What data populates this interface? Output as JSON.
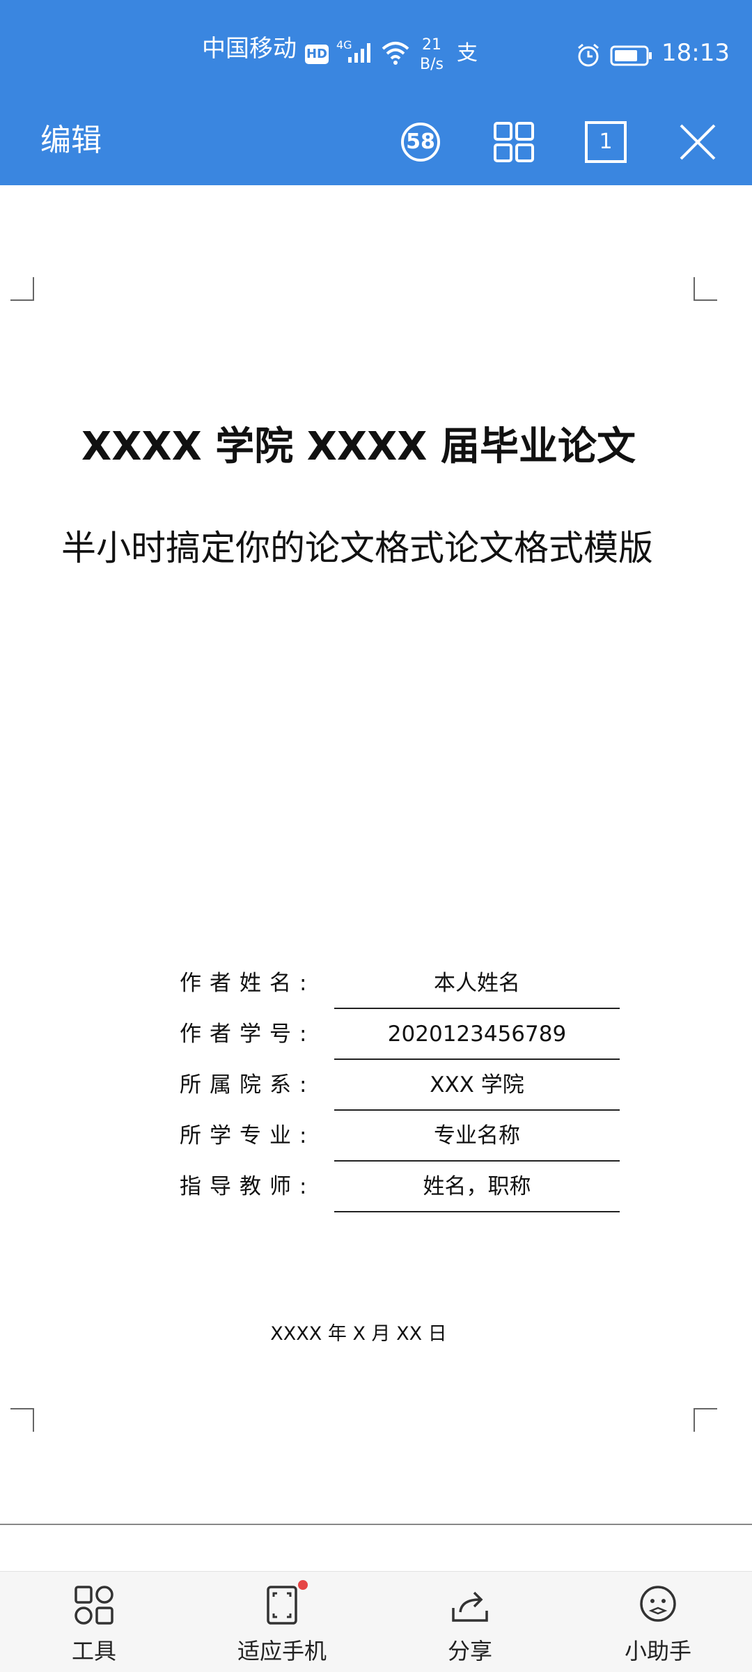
{
  "status_bar": {
    "carrier": "中国移动",
    "hd_badge": "HD",
    "network_type": "4G",
    "speed_value": "21",
    "speed_unit": "B/s",
    "alipay_glyph": "支",
    "time": "18:13"
  },
  "toolbar": {
    "edit_label": "编辑",
    "notification_count": "58",
    "page_number": "1",
    "icons": [
      "notification-count-icon",
      "grid-view-icon",
      "page-count-icon",
      "close-icon"
    ]
  },
  "document": {
    "title": "XXXX 学院 XXXX 届毕业论文",
    "subtitle": "半小时搞定你的论文格式论文格式模版",
    "info_rows": [
      {
        "label": "作者姓名:",
        "value": "本人姓名"
      },
      {
        "label": "作者学号:",
        "value": "2020123456789"
      },
      {
        "label": "所属院系:",
        "value": "XXX 学院"
      },
      {
        "label": "所学专业:",
        "value": "专业名称"
      },
      {
        "label": "指导教师:",
        "value": "姓名，职称"
      }
    ],
    "date": "XXXX 年 X 月 XX 日"
  },
  "bottom_bar": {
    "items": [
      {
        "label": "工具",
        "icon": "tools-icon"
      },
      {
        "label": "适应手机",
        "icon": "fit-screen-icon"
      },
      {
        "label": "分享",
        "icon": "share-icon"
      },
      {
        "label": "小助手",
        "icon": "assistant-icon"
      }
    ]
  },
  "colors": {
    "header_blue": "#3a86e0",
    "notification_dot": "#e54545"
  }
}
